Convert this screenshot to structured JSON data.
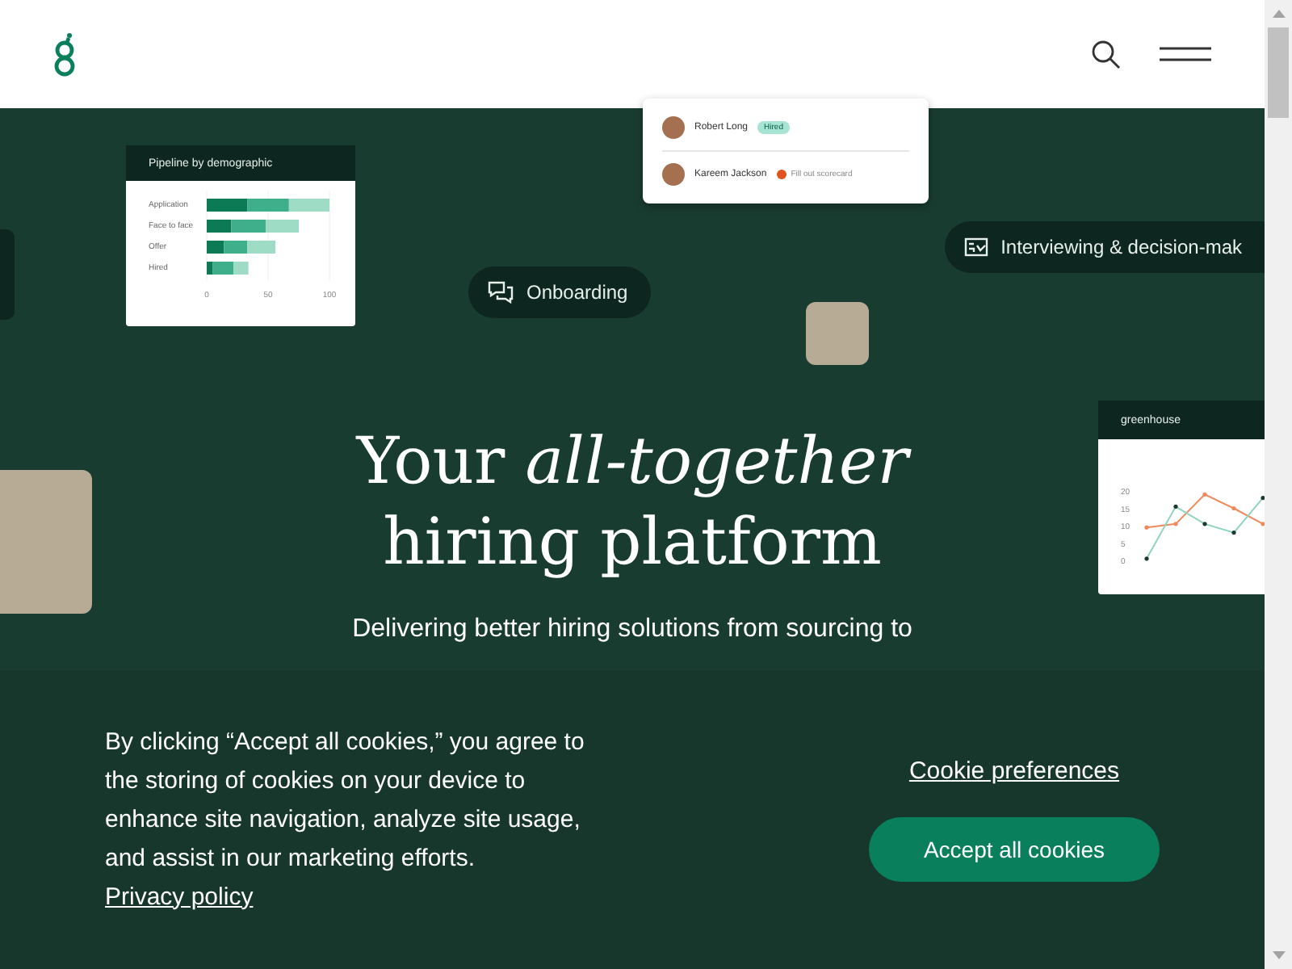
{
  "hero": {
    "title_line_1": "Your *all-together*",
    "title_line_2": "hiring platform",
    "subtitle": "Delivering better hiring solutions from sourcing to",
    "pills": [
      {
        "kind": "chat",
        "label": "Onboarding"
      },
      {
        "kind": "board",
        "label": "Interviewing & decision-mak"
      }
    ],
    "pipeline_card": {
      "title": "Pipeline by demographic",
      "chart_data": {
        "type": "bar",
        "orientation": "horizontal",
        "stacked": true,
        "categories": [
          "Application",
          "Face to face",
          "Offer",
          "Hired"
        ],
        "xticks": [
          0,
          50,
          100
        ],
        "xlim": [
          0,
          100
        ],
        "series": [
          {
            "color": "#0b7a55",
            "values": [
              33,
              20,
              14,
              5
            ]
          },
          {
            "color": "#3fae8a",
            "values": [
              34,
              28,
              19,
              17
            ]
          },
          {
            "color": "#9edcc6",
            "values": [
              33,
              27,
              23,
              12
            ]
          }
        ]
      }
    },
    "candidates_card": {
      "rows": [
        {
          "name": "Robert Long",
          "badge": "Hired"
        },
        {
          "name": "Kareem Jackson",
          "task": "Fill out scorecard"
        }
      ]
    },
    "report_card": {
      "logo": "greenhouse",
      "chart_data": {
        "type": "line",
        "yticks": [
          0,
          5,
          10,
          15,
          20
        ],
        "ylim": [
          0,
          20
        ],
        "series": [
          {
            "color": "#f08a5d",
            "values": [
              9.5,
              10.5,
              19,
              15,
              10.5
            ]
          },
          {
            "color": "#8fd3c0",
            "values": [
              0.5,
              15.5,
              10.5,
              8,
              18
            ]
          }
        ]
      }
    }
  },
  "cookie_banner": {
    "text": "By clicking “Accept all cookies,” you agree to the storing of cookies on your device to enhance site navigation, analyze site usage, and assist in our marketing efforts.",
    "link": "Privacy policy",
    "preferences": "Cookie preferences",
    "accept": "Accept all cookies"
  }
}
